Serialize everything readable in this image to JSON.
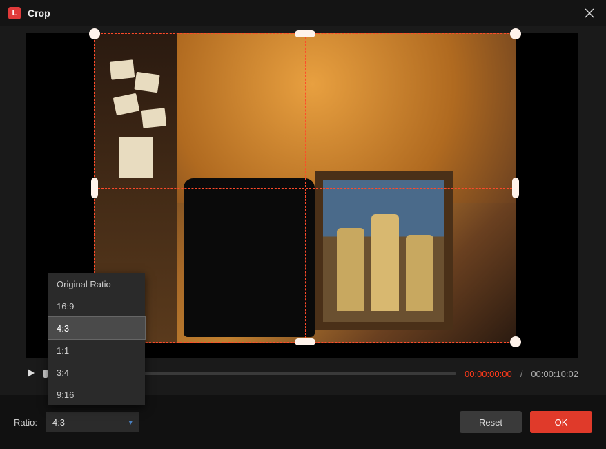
{
  "titlebar": {
    "title": "Crop"
  },
  "playback": {
    "current_time": "00:00:00:00",
    "separator": "/",
    "total_time": "00:00:10:02"
  },
  "ratio": {
    "label": "Ratio:",
    "selected": "4:3",
    "options": [
      "Original Ratio",
      "16:9",
      "4:3",
      "1:1",
      "3:4",
      "9:16"
    ]
  },
  "buttons": {
    "reset": "Reset",
    "ok": "OK"
  },
  "icons": {
    "close": "close-icon",
    "play": "play-icon",
    "chevron_down": "chevron-down-icon"
  },
  "colors": {
    "accent": "#e03a2a",
    "crop_outline": "#ff4a2a",
    "time_current": "#ff3a1a"
  }
}
